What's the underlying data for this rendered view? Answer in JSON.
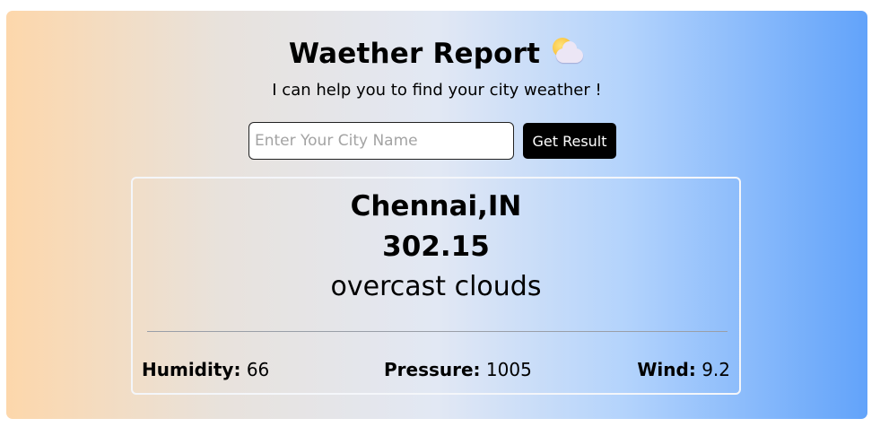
{
  "header": {
    "title": "Waether Report",
    "subtitle": "I can help you to find your city weather !"
  },
  "icons": {
    "title_icon": "sun-behind-cloud-icon"
  },
  "search": {
    "value": "",
    "placeholder": "Enter Your City Name",
    "button_label": "Get Result"
  },
  "result": {
    "city": "Chennai,IN",
    "temperature": "302.15",
    "description": "overcast clouds",
    "humidity_label": "Humidity:",
    "humidity_value": "66",
    "pressure_label": "Pressure:",
    "pressure_value": "1005",
    "wind_label": "Wind:",
    "wind_value": "9.2"
  },
  "colors": {
    "gradient_left": "#fdd7ab",
    "gradient_right": "#62a3fa",
    "button_bg": "#000000",
    "button_text": "#ffffff"
  }
}
